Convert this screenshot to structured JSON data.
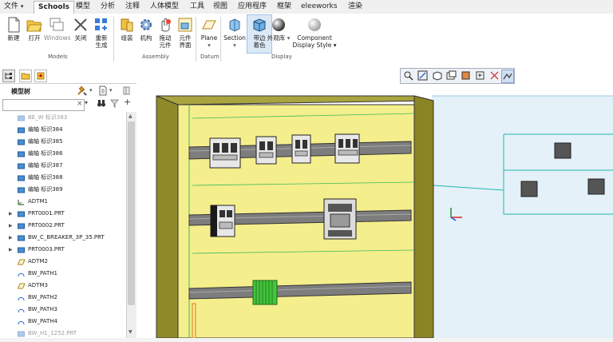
{
  "menubar": {
    "tabs": [
      "文件",
      "Schools",
      "模型",
      "分析",
      "注释",
      "人体模型",
      "工具",
      "视图",
      "应用程序",
      "框架",
      "eleeworks",
      "渲染"
    ],
    "file_arrow": "▾"
  },
  "ribbon": {
    "buttons": {
      "new": "新建",
      "open": "打开",
      "windows": "Windows",
      "close": "关闭",
      "regen_1": "重新",
      "regen_2": "生成",
      "assemble": "组装",
      "mechanism": "机构",
      "drag_1": "拖动",
      "drag_2": "元件",
      "comp_1": "元件",
      "comp_2": "界面",
      "plane": "Plane",
      "section": "Section",
      "shading_1": "带边",
      "shading_2": "着色",
      "appearance": "外观库",
      "display_style_1": "Component",
      "display_style_2": "Display Style"
    },
    "groups": {
      "models": "Models",
      "assembly": "Assembly",
      "datum": "Datum",
      "display": "Display"
    }
  },
  "sidebar": {
    "title": "模型树",
    "tree_items": [
      {
        "label": "BE_W  标识383",
        "icon": "part-icon",
        "faded": true
      },
      {
        "label": "编轴 标识384",
        "icon": "part-icon"
      },
      {
        "label": "编轴 标识385",
        "icon": "part-icon"
      },
      {
        "label": "编轴 标识386",
        "icon": "part-icon"
      },
      {
        "label": "编轴 标识387",
        "icon": "part-icon"
      },
      {
        "label": "编轴 标识388",
        "icon": "part-icon"
      },
      {
        "label": "编轴 标识389",
        "icon": "part-icon"
      },
      {
        "label": "ADTM1",
        "icon": "csys-icon"
      },
      {
        "label": "PRT0001.PRT",
        "icon": "part-icon",
        "expand": true
      },
      {
        "label": "PRT0002.PRT",
        "icon": "part-icon",
        "expand": true
      },
      {
        "label": "BW_C_BREAKER_3P_35.PRT",
        "icon": "part-icon",
        "expand": true
      },
      {
        "label": "PRT0003.PRT",
        "icon": "part-icon",
        "expand": true
      },
      {
        "label": "ADTM2",
        "icon": "datum-plane-icon"
      },
      {
        "label": "BW_PATH1",
        "icon": "path-icon"
      },
      {
        "label": "ADTM3",
        "icon": "datum-plane-icon"
      },
      {
        "label": "BW_PATH2",
        "icon": "path-icon"
      },
      {
        "label": "BW_PATH3",
        "icon": "path-icon"
      },
      {
        "label": "BW_PATH4",
        "icon": "path-icon"
      },
      {
        "label": "BW_H1_1252.PRT",
        "icon": "part-icon",
        "faded": true
      }
    ]
  },
  "colors": {
    "panel_yellow": "#f5ee8c",
    "panel_side": "#8f8a28",
    "component_green": "#44c53c",
    "rail_gray": "#7d7d7d",
    "viewport_bg": "#ddeef8"
  }
}
